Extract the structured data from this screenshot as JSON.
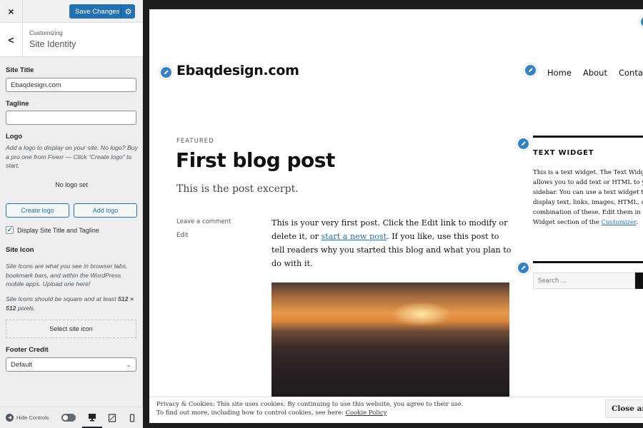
{
  "customizer": {
    "close_label": "×",
    "save_label": "Save Changes",
    "breadcrumb": {
      "parent": "Customizing",
      "current": "Site Identity"
    },
    "site_title": {
      "label": "Site Title",
      "value": "Ebaqdesign.com"
    },
    "tagline": {
      "label": "Tagline",
      "value": ""
    },
    "logo": {
      "label": "Logo",
      "description": "Add a logo to display on your site. No logo? Buy a pro one from Fiverr — Click “Create logo” to start.",
      "status": "No logo set",
      "create_button": "Create logo",
      "add_button": "Add logo"
    },
    "display_title_tagline": {
      "label": "Display Site Title and Tagline",
      "checked": true
    },
    "site_icon": {
      "label": "Site Icon",
      "description1": "Site Icons are what you see in browser tabs, bookmark bars, and within the WordPress mobile apps. Upload one here!",
      "description2_pre": "Site Icons should be square and at least ",
      "description2_bold": "512 × 512",
      "description2_post": " pixels.",
      "select_button": "Select site icon"
    },
    "footer_credit": {
      "label": "Footer Credit",
      "selected": "Default"
    },
    "footer": {
      "hide_controls": "Hide Controls",
      "devices": [
        "desktop",
        "tablet",
        "mobile"
      ],
      "active_device": "desktop"
    }
  },
  "preview": {
    "site_title": "Ebaqdesign.com",
    "nav": [
      "Home",
      "About",
      "Conta"
    ],
    "post": {
      "category": "FEATURED",
      "title": "First blog post",
      "excerpt": "This is the post excerpt.",
      "meta_comment": "Leave a comment",
      "meta_edit": "Edit",
      "body_1": "This is your very first post. Click the Edit link to modify or delete it, or ",
      "body_link": "start a new post",
      "body_2": ". If you like, use this post to tell readers why you started this blog and what you plan to do with it.",
      "image_alt": "sunset over ocean waves"
    },
    "widget": {
      "title": "TEXT WIDGET",
      "lines": [
        "This is a text widget. The Text Widge",
        "allows you to add text or HTML to yo",
        "sidebar. You can use a text widget to",
        "display text, links, images, HTML, o",
        "combination of these. Edit them in t"
      ],
      "last_pre": "Widget section of the ",
      "last_link": "Customizer",
      "last_post": "."
    },
    "search_placeholder": "Search …",
    "cookie": {
      "line1": "Privacy & Cookies: This site uses cookies. By continuing to use this website, you agree to their use.",
      "line2_pre": "To find out more, including how to control cookies, see here: ",
      "line2_link": "Cookie Policy",
      "close_button": "Close and"
    }
  },
  "colors": {
    "accent": "#2271b1",
    "shortcut": "#3582c4",
    "frame": "#1d1d1d"
  }
}
